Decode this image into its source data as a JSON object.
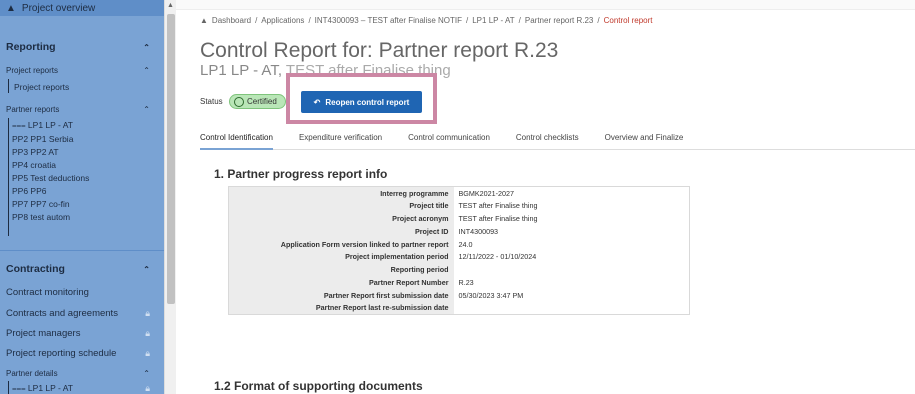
{
  "sidebar": {
    "project_overview": "Project overview",
    "reporting": "Reporting",
    "project_reports_header": "Project reports",
    "project_reports_item": "Project reports",
    "partner_reports_header": "Partner reports",
    "partner_items": [
      "LP1 LP - AT",
      "PP2 PP1 Serbia",
      "PP3 PP2 AT",
      "PP4 croatia",
      "PP5 Test deductions",
      "PP6 PP6",
      "PP7 PP7 co-fin",
      "PP8 test autom"
    ],
    "contracting": "Contracting",
    "contract_monitoring": "Contract monitoring",
    "contracts_and_agreements": "Contracts and agreements",
    "project_managers": "Project managers",
    "project_reporting_schedule": "Project reporting schedule",
    "partner_details": "Partner details",
    "partner_details_item": "LP1 LP - AT"
  },
  "breadcrumb": {
    "items": [
      "Dashboard",
      "Applications",
      "INT4300093 – TEST after Finalise NOTIF",
      "LP1 LP - AT",
      "Partner report R.23"
    ],
    "current": "Control report"
  },
  "header": {
    "title": "Control Report for: Partner report R.23",
    "subtitle_visible": "LP1 LP - AT,",
    "subtitle_obscured": "TEST after Finalise thing"
  },
  "status": {
    "label": "Status",
    "badge": "Certified",
    "reopen_button": "Reopen control report"
  },
  "tabs": [
    "Control Identification",
    "Expenditure verification",
    "Control communication",
    "Control checklists",
    "Overview and Finalize"
  ],
  "section1": {
    "title": "1. Partner progress report info",
    "rows": [
      {
        "label": "Interreg programme",
        "value": "BGMK2021-2027"
      },
      {
        "label": "Project title",
        "value": "TEST after Finalise thing"
      },
      {
        "label": "Project acronym",
        "value": "TEST after Finalise thing"
      },
      {
        "label": "Project ID",
        "value": "INT4300093"
      },
      {
        "label": "Application Form version linked to partner report",
        "value": "24.0"
      },
      {
        "label": "Project implementation period",
        "value": "12/11/2022 - 01/10/2024"
      },
      {
        "label": "Reporting period",
        "value": ""
      },
      {
        "label": "Partner Report Number",
        "value": "R.23"
      },
      {
        "label": "Partner Report first submission date",
        "value": "05/30/2023 3:47 PM"
      },
      {
        "label": "Partner Report last re-submission date",
        "value": ""
      }
    ]
  },
  "section2": {
    "title": "1.2 Format of supporting documents"
  }
}
